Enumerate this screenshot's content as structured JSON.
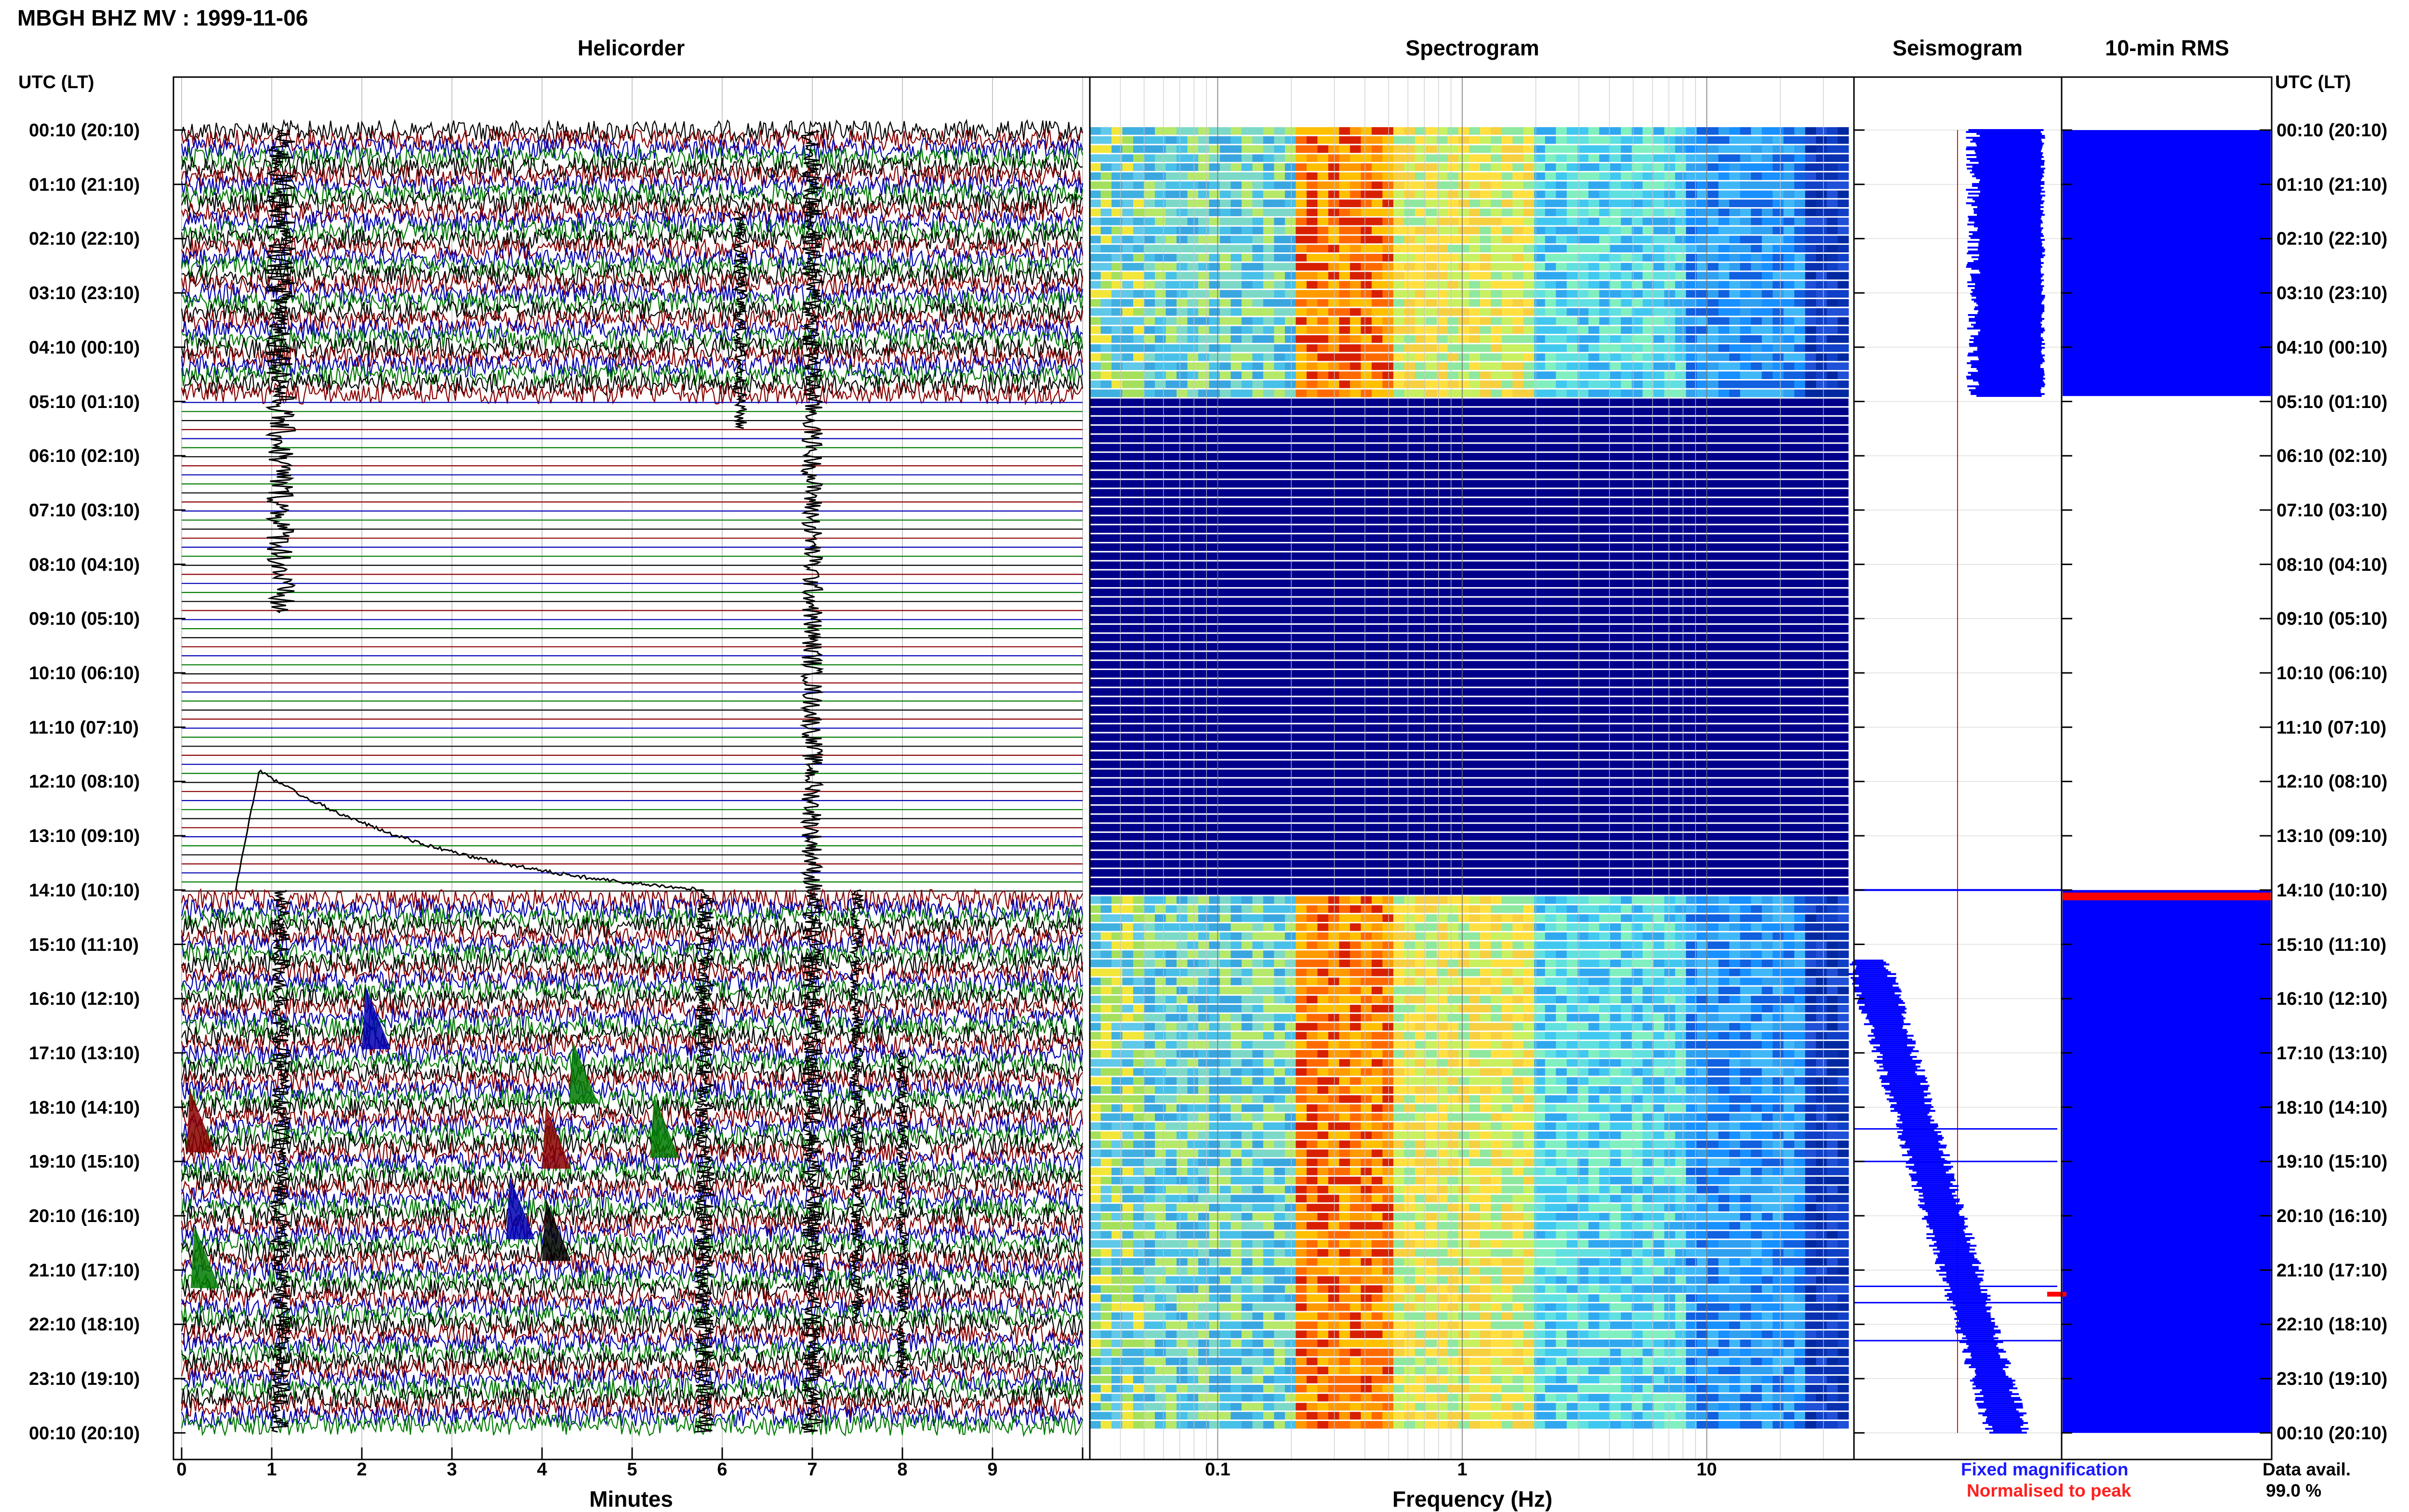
{
  "header": {
    "title": "MBGH BHZ MV : 1999-11-06"
  },
  "panels": {
    "helicorder": "Helicorder",
    "spectrogram": "Spectrogram",
    "seismogram": "Seismogram",
    "rms": "10-min RMS"
  },
  "axes": {
    "time_label": "UTC (LT)",
    "minutes_label": "Minutes",
    "frequency_label": "Frequency (Hz)"
  },
  "legend": {
    "fixed": "Fixed magnification",
    "normalised": "Normalised to peak",
    "avail_label": "Data avail.",
    "avail_value": "99.0 %"
  },
  "colors": {
    "trace_cycle": [
      "#000000",
      "#8b0000",
      "#0000b4",
      "#007a00"
    ],
    "spectrogram_empty": "#00008b",
    "fixed": "#0000ff",
    "normalised": "#ff0000"
  },
  "chart_data": [
    {
      "type": "line",
      "name": "Helicorder",
      "title": "Helicorder",
      "xlabel": "Minutes",
      "ylabel": "UTC (LT)",
      "x_ticks": [
        0,
        1,
        2,
        3,
        4,
        5,
        6,
        7,
        8,
        9
      ],
      "xlim": [
        0,
        10
      ],
      "y_tick_labels": [
        "00:10 (20:10)",
        "01:10 (21:10)",
        "02:10 (22:10)",
        "03:10 (23:10)",
        "04:10 (00:10)",
        "05:10 (01:10)",
        "06:10 (02:10)",
        "07:10 (03:10)",
        "08:10 (04:10)",
        "09:10 (05:10)",
        "10:10 (06:10)",
        "11:10 (07:10)",
        "12:10 (08:10)",
        "13:10 (09:10)",
        "14:10 (10:10)",
        "15:10 (11:10)",
        "16:10 (12:10)",
        "17:10 (13:10)",
        "18:10 (14:10)",
        "19:10 (15:10)",
        "20:10 (16:10)",
        "21:10 (17:10)",
        "22:10 (18:10)",
        "23:10 (19:10)",
        "00:10 (20:10)"
      ],
      "data_gap_hours": [
        4.9,
        14.0
      ],
      "transient_minutes": [
        1.1,
        5.8,
        7.0,
        7.5,
        8.0,
        6.2
      ]
    },
    {
      "type": "heatmap",
      "name": "Spectrogram",
      "title": "Spectrogram",
      "xlabel": "Frequency (Hz)",
      "x_scale": "log",
      "x_tick_labels": [
        "0.1",
        "1",
        "10"
      ],
      "xlim": [
        0.03,
        40
      ],
      "peak_band_hz": [
        0.2,
        0.5
      ],
      "data_gap_hours": [
        4.9,
        14.0
      ]
    },
    {
      "type": "line",
      "name": "Seismogram",
      "title": "Seismogram",
      "series": [
        {
          "name": "Fixed magnification",
          "hours": [
            0,
            4.9
          ],
          "trend": "flat"
        },
        {
          "name": "Fixed magnification",
          "hours": [
            15.3,
            24
          ],
          "trend": "increasing"
        }
      ]
    },
    {
      "type": "bar",
      "name": "10-min RMS",
      "title": "10-min RMS",
      "segments_hours": [
        [
          0,
          4.9
        ],
        [
          14.0,
          24.0
        ]
      ],
      "spike_hour": 14.1,
      "data_availability_percent": 99.0
    }
  ]
}
